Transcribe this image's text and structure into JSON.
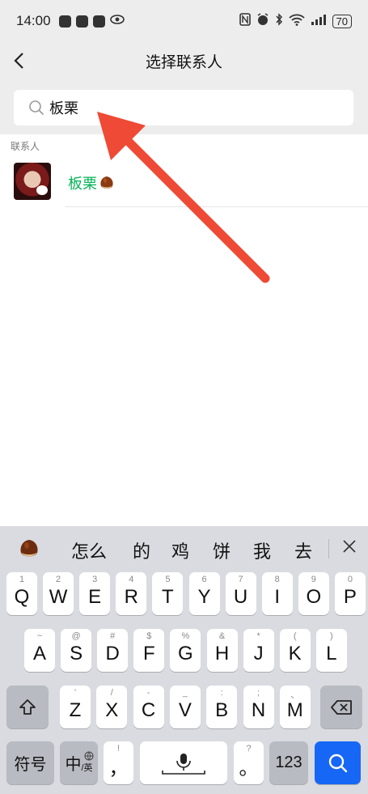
{
  "status_bar": {
    "time": "14:00",
    "battery": "70"
  },
  "header": {
    "title": "选择联系人",
    "back_icon": "back-chevron-icon"
  },
  "search": {
    "value": "板栗"
  },
  "results": {
    "section_label": "联系人",
    "contacts": [
      {
        "name": "板栗"
      }
    ]
  },
  "keyboard": {
    "candidates": [
      "怎么",
      "的",
      "鸡",
      "饼",
      "我",
      "去"
    ],
    "row1": [
      {
        "hint": "1",
        "key": "Q"
      },
      {
        "hint": "2",
        "key": "W"
      },
      {
        "hint": "3",
        "key": "E"
      },
      {
        "hint": "4",
        "key": "R"
      },
      {
        "hint": "5",
        "key": "T"
      },
      {
        "hint": "6",
        "key": "Y"
      },
      {
        "hint": "7",
        "key": "U"
      },
      {
        "hint": "8",
        "key": "I"
      },
      {
        "hint": "9",
        "key": "O"
      },
      {
        "hint": "0",
        "key": "P"
      }
    ],
    "row2": [
      {
        "hint": "~",
        "key": "A"
      },
      {
        "hint": "@",
        "key": "S"
      },
      {
        "hint": "#",
        "key": "D"
      },
      {
        "hint": "$",
        "key": "F"
      },
      {
        "hint": "%",
        "key": "G"
      },
      {
        "hint": "&",
        "key": "H"
      },
      {
        "hint": "*",
        "key": "J"
      },
      {
        "hint": "(",
        "key": "K"
      },
      {
        "hint": ")",
        "key": "L"
      }
    ],
    "row3": [
      {
        "hint": "'",
        "key": "Z"
      },
      {
        "hint": "/",
        "key": "X"
      },
      {
        "hint": "-",
        "key": "C"
      },
      {
        "hint": "_",
        "key": "V"
      },
      {
        "hint": ":",
        "key": "B"
      },
      {
        "hint": ";",
        "key": "N"
      },
      {
        "hint": "、",
        "key": "M"
      }
    ],
    "symbol_key": "符号",
    "lang_key_main": "中",
    "lang_key_sub": "/英",
    "comma_hint": "!",
    "comma_key": "，",
    "period_hint": "?",
    "period_key": "。",
    "num_key": "123"
  },
  "colors": {
    "accent_green": "#07b458",
    "arrow_red": "#ee4a35",
    "search_key_blue": "#1667f5"
  }
}
